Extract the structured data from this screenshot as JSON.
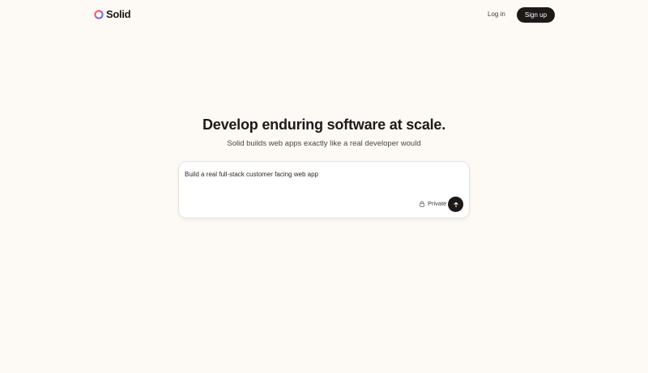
{
  "header": {
    "logo_text": "Solid",
    "login_label": "Log in",
    "signup_label": "Sign up"
  },
  "hero": {
    "title": "Develop enduring software at scale.",
    "subtitle": "Solid builds web apps exactly like a real developer would"
  },
  "prompt": {
    "value": "Build a real full-stack customer facing web app",
    "privacy_label": "Private",
    "privacy_icon": "lock-icon",
    "send_icon": "arrow-up-icon"
  },
  "colors": {
    "background": "#fdfaf6",
    "primary": "#1c1917",
    "logo_gradient": [
      "#f97316",
      "#ec4899",
      "#8b5cf6",
      "#3b82f6"
    ]
  }
}
